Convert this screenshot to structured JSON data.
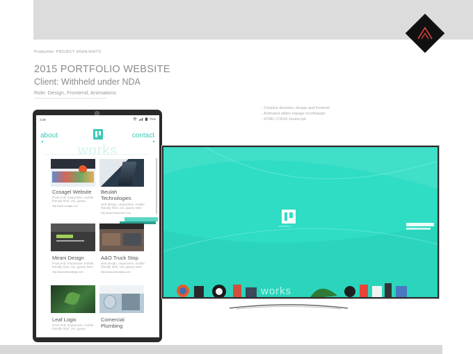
{
  "header": {
    "eyebrow": "Production: PROJECT HIGHLIGHTS",
    "title": "2015 PORTFOLIO WEBSITE",
    "client": "Client: Withheld under NDA",
    "role": "Role: Design, Frontend,  Animations"
  },
  "notes": [
    "- Creative direction, design and frontend",
    "- Animated slides onpage scroll/swipe",
    "- HTML/ CSS3/ Javascript"
  ],
  "phone": {
    "status_time": "2:28",
    "battery": "71%",
    "nav_about": "about",
    "nav_contact": "contact",
    "works_word": "works",
    "cards": [
      {
        "title": "Cosagel Website",
        "desc": "Front end, responsive, mobile friendly html, css, jquery",
        "link": "http://www.cosagel.com",
        "thumb": "#3d6fb0"
      },
      {
        "title": "Beulah Technologies",
        "desc": "web design, responsive, mobile friendly html, css, jquery SEO",
        "link": "http://www.beulah.tech.com",
        "thumb": "#3a4a5a"
      },
      {
        "title": "Mirani Design",
        "desc": "Front end, responsive, mobile friendly html, css, jquery SEO",
        "link": "http://www.miranidesign.com",
        "thumb": "#3c3c3c"
      },
      {
        "title": "A&O Truck Stop",
        "desc": "web design, responsive, mobile friendly html, css, jquery SEO",
        "link": "http://www.aotruckstop.com",
        "thumb": "#4a3a34"
      },
      {
        "title": "Leaf Logix",
        "desc": "Front end, responsive, mobile friendly html, css, jquery",
        "link": "",
        "thumb": "#2e5a34"
      },
      {
        "title": "Comercial Plumbing",
        "desc": "",
        "link": "",
        "thumb": "#9fb8c8"
      }
    ]
  },
  "monitor": {
    "works_word": "works",
    "logo_caption": "PORTFOLIO"
  },
  "colors": {
    "accent": "#3cc9b5",
    "monitor_bg": "#2fdcc4"
  }
}
